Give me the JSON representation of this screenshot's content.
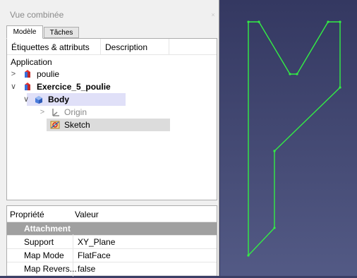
{
  "panel": {
    "title": "Vue combinée",
    "close_glyph": "×",
    "tabs": [
      {
        "label": "Modèle"
      },
      {
        "label": "Tâches"
      }
    ]
  },
  "tree": {
    "columns": [
      "Étiquettes & attributs",
      "Description"
    ],
    "root_label": "Application",
    "items": [
      {
        "label": "poulie",
        "chevron": ">",
        "icon": "part-icon"
      },
      {
        "label": "Exercice_5_poulie",
        "chevron": "∨",
        "icon": "part-icon"
      },
      {
        "label": "Body",
        "chevron": "∨",
        "icon": "body-icon"
      },
      {
        "label": "Origin",
        "chevron": ">",
        "icon": "origin-icon"
      },
      {
        "label": "Sketch",
        "chevron": "",
        "icon": "sketch-icon"
      }
    ]
  },
  "properties": {
    "columns": [
      "Propriété",
      "Valeur"
    ],
    "group": "Attachment",
    "rows": [
      {
        "name": "Support",
        "value": "XY_Plane"
      },
      {
        "name": "Map Mode",
        "value": "FlatFace"
      },
      {
        "name": "Map Revers...",
        "value": "false"
      }
    ]
  },
  "colors": {
    "selection": "#e0e0f8",
    "sketch_line": "#33ee44",
    "viewport_top": "#343861",
    "viewport_bottom": "#535a85"
  }
}
